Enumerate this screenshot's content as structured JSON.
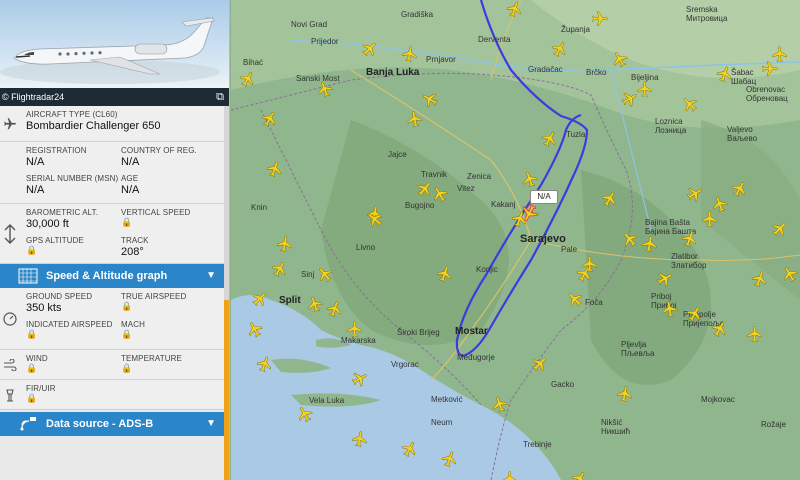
{
  "panel": {
    "photo_credit": "© Flightradar24",
    "aircraft_type_label": "AIRCRAFT TYPE (CL60)",
    "aircraft_type_value": "Bombardier Challenger 650",
    "registration_label": "REGISTRATION",
    "registration_value": "N/A",
    "country_label": "COUNTRY OF REG.",
    "country_value": "N/A",
    "serial_label": "SERIAL NUMBER (MSN)",
    "serial_value": "N/A",
    "age_label": "AGE",
    "age_value": "N/A",
    "baro_alt_label": "BAROMETRIC ALT.",
    "baro_alt_value": "30,000 ft",
    "vertical_speed_label": "VERTICAL SPEED",
    "gps_alt_label": "GPS ALTITUDE",
    "track_label": "TRACK",
    "track_value": "208°",
    "speed_section_title": "Speed & Altitude graph",
    "ground_speed_label": "GROUND SPEED",
    "ground_speed_value": "350 kts",
    "true_airspeed_label": "TRUE AIRSPEED",
    "indicated_airspeed_label": "INDICATED AIRSPEED",
    "mach_label": "MACH",
    "wind_label": "WIND",
    "temperature_label": "TEMPERATURE",
    "fir_label": "FIR/UIR",
    "data_source_title": "Data source - ADS-B"
  },
  "map": {
    "callout_text": "N/A",
    "cities": {
      "sarajevo": "Sarajevo",
      "banja_luka": "Banja Luka",
      "mostar": "Mostar",
      "split": "Split",
      "zenica": "Zenica",
      "tuzla": "Tuzla",
      "brcko": "Brčko",
      "bijeljina": "Bijeljina",
      "sabac": "Šabac\nШабац",
      "valjevo": "Valjevo\nВаљево",
      "novi_grad": "Novi Grad",
      "prijedor": "Prijedor",
      "sanski_most": "Sanski Most",
      "bihac": "Bihać",
      "prnjavor": "Prnjavor",
      "derventa": "Derventa",
      "gradacac": "Gradačac",
      "zupanja": "Županja",
      "gradiska": "Gradiška",
      "sremska": "Sremska\nМитровица",
      "obrenovac": "Obrenovac\nОбреновац",
      "loznica": "Loznica\nЛозница",
      "bajina": "Bajina Bašta\nБајина Башта",
      "zlatibor": "Zlatibor\nЗлатибор",
      "priboj": "Priboj\nПрибој",
      "prijepolje": "Prijepolje\nПријепоље",
      "pljevlja": "Pljevlja\nПљевља",
      "foca": "Foča",
      "pale": "Pale",
      "jajce": "Jajce",
      "travnik": "Travnik",
      "vitez": "Vitez",
      "bugojno": "Bugojno",
      "livno": "Livno",
      "knin": "Knin",
      "siroki": "Široki Brijeg",
      "makarska": "Makarska",
      "medugorje": "Međugorje",
      "metkovic": "Metković",
      "neum": "Neum",
      "vela_luka": "Vela Luka",
      "trebinje": "Trebinje",
      "niksic": "Nikšić\nНикшић",
      "rozaje": "Rožaje",
      "mojkovac": "Mojkovac",
      "gacko": "Gacko",
      "vrgorac": "Vrgorac",
      "sinj": "Sinj",
      "konjic": "Konjic",
      "kakanj": "Kakanj"
    }
  }
}
